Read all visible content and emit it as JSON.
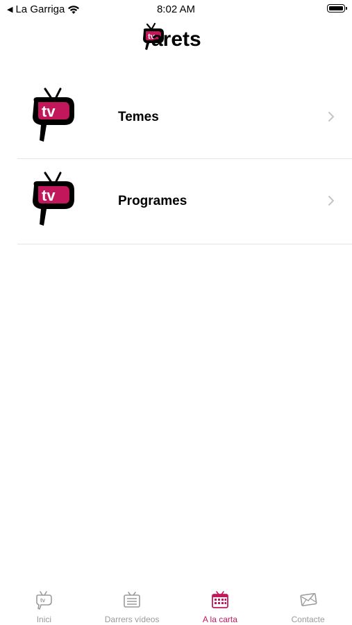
{
  "status_bar": {
    "back_label": "La Garriga",
    "time": "8:02 AM"
  },
  "header": {
    "logo_text": "arets",
    "logo_badge": "tv"
  },
  "list": {
    "items": [
      {
        "label": "Temes",
        "icon": "tv-parets-logo-icon"
      },
      {
        "label": "Programes",
        "icon": "tv-parets-logo-icon"
      }
    ]
  },
  "tab_bar": {
    "active_color": "#c2185b",
    "inactive_color": "#9a9a9a",
    "tabs": [
      {
        "label": "Inici",
        "icon": "home-tv-icon"
      },
      {
        "label": "Darrers vídeos",
        "icon": "list-tv-icon"
      },
      {
        "label": "A la carta",
        "icon": "calendar-tv-icon",
        "active": true
      },
      {
        "label": "Contacte",
        "icon": "mail-icon"
      }
    ]
  },
  "colors": {
    "brand": "#c2185b",
    "divider": "#e4e4e4"
  }
}
